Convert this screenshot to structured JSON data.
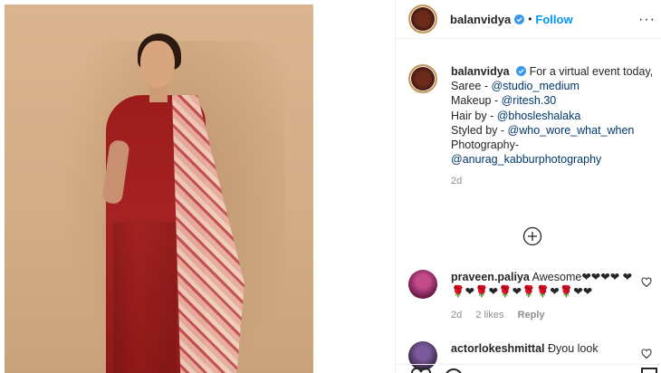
{
  "post": {
    "username": "balanvidya",
    "follow_label": "Follow",
    "dot": "•",
    "more": "···"
  },
  "caption": {
    "username": "balanvidya",
    "intro": "For a virtual event today,",
    "lines": [
      {
        "label": "Saree - ",
        "mention": "@studio_medium"
      },
      {
        "label": "Makeup - ",
        "mention": "@ritesh.30"
      },
      {
        "label": "Hair by - ",
        "mention": "@bhosleshalaka"
      },
      {
        "label": "Styled by - ",
        "mention": "@who_wore_what_when"
      },
      {
        "label": "Photography-",
        "mention": ""
      },
      {
        "label": "",
        "mention": "@anurag_kabburphotography"
      }
    ],
    "time": "2d"
  },
  "comments": [
    {
      "username": "praveen.paliya",
      "text": "Awesome❤❤❤❤ ❤🌹❤🌹❤🌹❤🌹🌹❤🌹❤❤",
      "time": "2d",
      "likes": "2 likes",
      "reply": "Reply"
    },
    {
      "username": "actorlokeshmittal",
      "text": "Ðyou look"
    }
  ],
  "icons": [
    "verified-icon",
    "more-icon",
    "load-more-icon",
    "heart-icon",
    "like-icon",
    "comment-icon",
    "bookmark-icon"
  ],
  "colors": {
    "link": "#0095f6",
    "mention": "#00376b",
    "muted": "#8e8e8e"
  }
}
